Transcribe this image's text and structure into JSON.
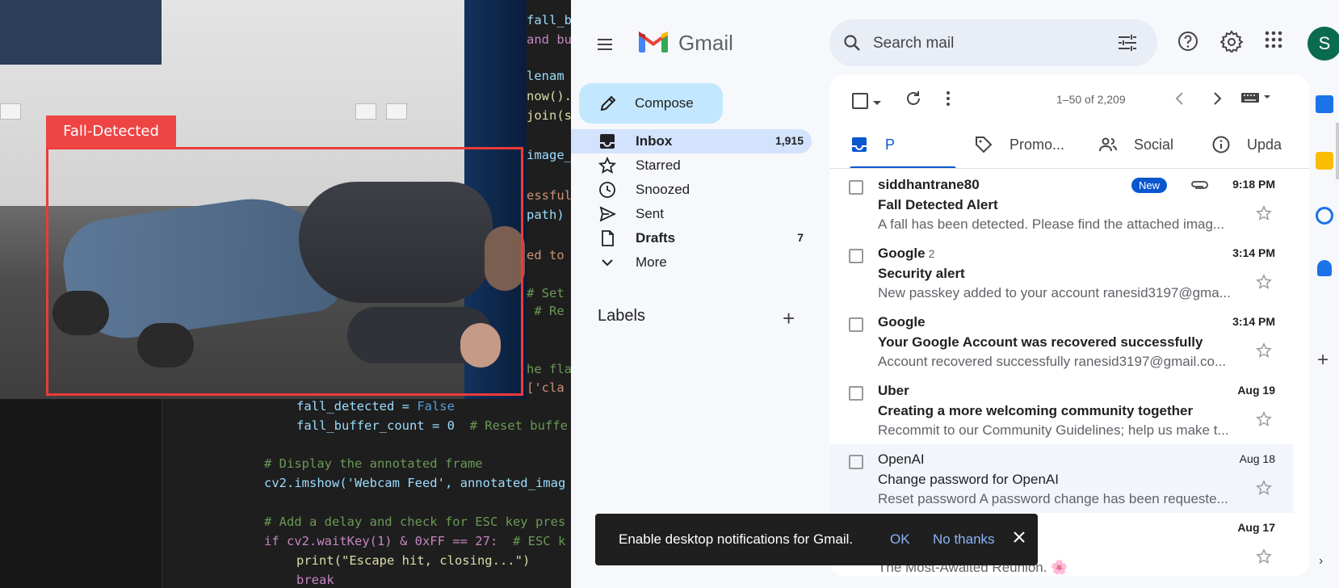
{
  "left_panel": {
    "detection_label": "Fall-Detected",
    "code_lines": [
      {
        "text": "fall_bu",
        "cls": "c-var"
      },
      {
        "text": "and but",
        "cls": "c-kw"
      },
      {
        "text": "lenam",
        "cls": "c-var"
      },
      {
        "text": "now().s",
        "cls": "c-fn"
      },
      {
        "text": "join(sa",
        "cls": "c-fn"
      },
      {
        "text": "image_",
        "cls": "c-var"
      },
      {
        "text": "essful",
        "cls": "c-str"
      },
      {
        "text": "path)",
        "cls": "c-var"
      },
      {
        "text": "ed to",
        "cls": "c-str"
      },
      {
        "text": "# Set",
        "cls": "c-cm"
      },
      {
        "text": " # Re",
        "cls": "c-cm"
      },
      {
        "text": "he flag",
        "cls": "c-cm"
      },
      {
        "text": "['cla",
        "cls": "c-str"
      }
    ],
    "code_bottom": [
      {
        "text": "fall_detected = ",
        "extra": "False"
      },
      {
        "text": "fall_buffer_count = 0  ",
        "extra": "# Reset buffe"
      },
      {
        "text": "# Display the annotated frame",
        "extra": ""
      },
      {
        "text": "cv2.imshow('Webcam Feed', annotated_imag",
        "extra": ""
      },
      {
        "text": "# Add a delay and check for ESC key pres",
        "extra": ""
      },
      {
        "text": "if cv2.waitKey(1) & 0xFF == 27:  ",
        "extra": "# ESC k"
      },
      {
        "text": "print(\"Escape hit, closing...\")",
        "extra": ""
      },
      {
        "text": "break",
        "extra": ""
      }
    ]
  },
  "gmail": {
    "wordmark": "Gmail",
    "search": {
      "placeholder": "Search mail"
    },
    "avatar_letter": "S",
    "compose_label": "Compose",
    "nav": [
      {
        "label": "Inbox",
        "count": "1,915",
        "icon": "inbox-icon",
        "active": true,
        "bold": true
      },
      {
        "label": "Starred",
        "count": "",
        "icon": "star-icon",
        "active": false,
        "bold": false
      },
      {
        "label": "Snoozed",
        "count": "",
        "icon": "clock-icon",
        "active": false,
        "bold": false
      },
      {
        "label": "Sent",
        "count": "",
        "icon": "send-icon",
        "active": false,
        "bold": false
      },
      {
        "label": "Drafts",
        "count": "7",
        "icon": "draft-icon",
        "active": false,
        "bold": true
      },
      {
        "label": "More",
        "count": "",
        "icon": "chevron-down-icon",
        "active": false,
        "bold": false
      }
    ],
    "labels_title": "Labels",
    "pagination": "1–50 of 2,209",
    "tabs": [
      {
        "label": "P",
        "icon": "inbox-tab-icon"
      },
      {
        "label": "Promo...",
        "icon": "tag-icon"
      },
      {
        "label": "Social",
        "icon": "people-icon"
      },
      {
        "label": "Upda",
        "icon": "info-icon"
      }
    ],
    "emails": [
      {
        "sender": "siddhantrane80",
        "count": "",
        "subject": "Fall Detected Alert",
        "snippet": "A fall has been detected. Please find the attached imag...",
        "date": "9:18 PM",
        "unread": true,
        "badge": "New",
        "attachment": true
      },
      {
        "sender": "Google",
        "count": "2",
        "subject": "Security alert",
        "snippet": "New passkey added to your account ranesid3197@gma...",
        "date": "3:14 PM",
        "unread": true,
        "badge": "",
        "attachment": false
      },
      {
        "sender": "Google",
        "count": "",
        "subject": "Your Google Account was recovered successfully",
        "snippet": "Account recovered successfully ranesid3197@gmail.co...",
        "date": "3:14 PM",
        "unread": true,
        "badge": "",
        "attachment": false
      },
      {
        "sender": "Uber",
        "count": "",
        "subject": "Creating a more welcoming community together",
        "snippet": "Recommit to our Community Guidelines; help us make t...",
        "date": "Aug 19",
        "unread": true,
        "badge": "",
        "attachment": false
      },
      {
        "sender": "OpenAI",
        "count": "",
        "subject": "Change password for OpenAI",
        "snippet": "Reset password A password change has been requeste...",
        "date": "Aug 18",
        "unread": false,
        "badge": "",
        "attachment": false
      },
      {
        "sender": "",
        "count": "",
        "subject": "",
        "snippet": "The Most-Awaited Reunion. 🌸",
        "date": "Aug 17",
        "unread": true,
        "badge": "",
        "attachment": false
      }
    ],
    "toast": {
      "message": "Enable desktop notifications for Gmail.",
      "ok": "OK",
      "no_thanks": "No thanks"
    }
  }
}
